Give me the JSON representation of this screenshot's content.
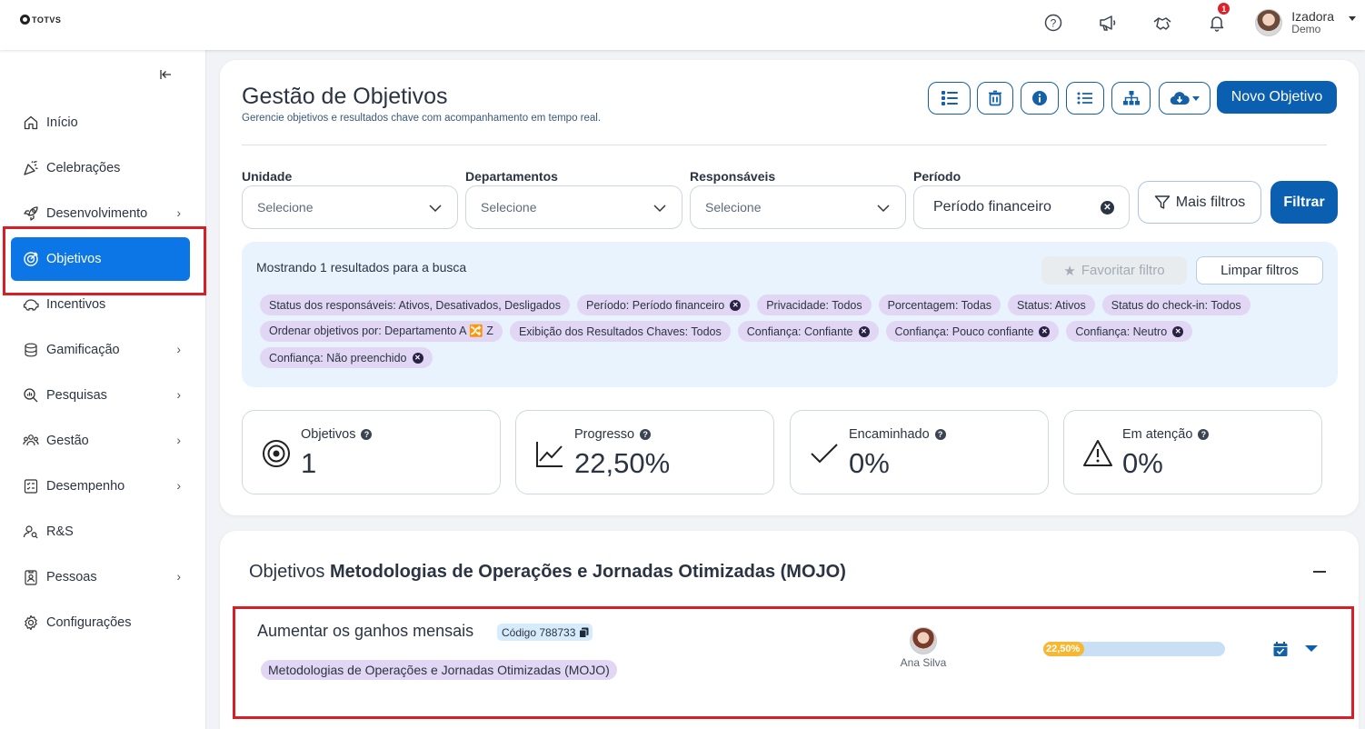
{
  "brand": {
    "logo_text": "TOTVS"
  },
  "user": {
    "name": "Izadora",
    "subtitle": "Demo",
    "notification_count": "1"
  },
  "sidebar": {
    "items": [
      {
        "label": "Início",
        "icon": "home-icon",
        "has_children": false
      },
      {
        "label": "Celebrações",
        "icon": "party-icon",
        "has_children": false
      },
      {
        "label": "Desenvolvimento",
        "icon": "rocket-icon",
        "has_children": true
      },
      {
        "label": "Objetivos",
        "icon": "target-icon",
        "has_children": false,
        "active": true
      },
      {
        "label": "Incentivos",
        "icon": "piggy-bank-icon",
        "has_children": false
      },
      {
        "label": "Gamificação",
        "icon": "coins-icon",
        "has_children": true
      },
      {
        "label": "Pesquisas",
        "icon": "search-chart-icon",
        "has_children": true
      },
      {
        "label": "Gestão",
        "icon": "people-icon",
        "has_children": true
      },
      {
        "label": "Desempenho",
        "icon": "checklist-icon",
        "has_children": true
      },
      {
        "label": "R&S",
        "icon": "user-search-icon",
        "has_children": false
      },
      {
        "label": "Pessoas",
        "icon": "id-badge-icon",
        "has_children": true
      },
      {
        "label": "Configurações",
        "icon": "gear-icon",
        "has_children": false
      }
    ]
  },
  "header": {
    "title": "Gestão de Objetivos",
    "subtitle": "Gerencie objetivos e resultados chave com acompanhamento em tempo real.",
    "new_button": "Novo Objetivo"
  },
  "filters": {
    "unidade": {
      "label": "Unidade",
      "placeholder": "Selecione"
    },
    "departamentos": {
      "label": "Departamentos",
      "placeholder": "Selecione"
    },
    "responsaveis": {
      "label": "Responsáveis",
      "placeholder": "Selecione"
    },
    "periodo": {
      "label": "Período",
      "value": "Período financeiro"
    },
    "more_label": "Mais filtros",
    "filter_label": "Filtrar"
  },
  "results": {
    "text": "Mostrando 1 resultados para a busca",
    "favorite_label": "Favoritar filtro",
    "clear_label": "Limpar filtros",
    "chips": [
      {
        "label": "Status dos responsáveis: Ativos, Desativados, Desligados",
        "removable": false
      },
      {
        "label": "Período: Período financeiro",
        "removable": true
      },
      {
        "label": "Privacidade: Todos",
        "removable": false
      },
      {
        "label": "Porcentagem: Todas",
        "removable": false
      },
      {
        "label": "Status: Ativos",
        "removable": false
      },
      {
        "label": "Status do check-in: Todos",
        "removable": false
      },
      {
        "label": "Ordenar objetivos por: Departamento A 🔀 Z",
        "removable": false
      },
      {
        "label": "Exibição dos Resultados Chaves: Todos",
        "removable": false
      },
      {
        "label": "Confiança: Confiante",
        "removable": true
      },
      {
        "label": "Confiança: Pouco confiante",
        "removable": true
      },
      {
        "label": "Confiança: Neutro",
        "removable": true
      },
      {
        "label": "Confiança: Não preenchido",
        "removable": true
      }
    ]
  },
  "stats": [
    {
      "label": "Objetivos",
      "value": "1",
      "icon": "target-icon"
    },
    {
      "label": "Progresso",
      "value": "22,50%",
      "icon": "line-chart-icon"
    },
    {
      "label": "Encaminhado",
      "value": "0%",
      "icon": "check-icon"
    },
    {
      "label": "Em atenção",
      "value": "0%",
      "icon": "warning-icon"
    }
  ],
  "group": {
    "prefix": "Objetivos",
    "name": "Metodologias de Operações e Jornadas Otimizadas (MOJO)"
  },
  "objective": {
    "title": "Aumentar os ganhos mensais",
    "code": "Código 788733",
    "department": "Metodologias de Operações e Jornadas Otimizadas (MOJO)",
    "owner": "Ana Silva",
    "progress_label": "22,50%",
    "progress_value": 22.5
  },
  "colors": {
    "primary": "#0b5fb0",
    "active_nav": "#0c76e6",
    "highlight_box": "#d81f26",
    "chip_purple": "#e1d6f4",
    "progress_fill": "#f7b731"
  }
}
